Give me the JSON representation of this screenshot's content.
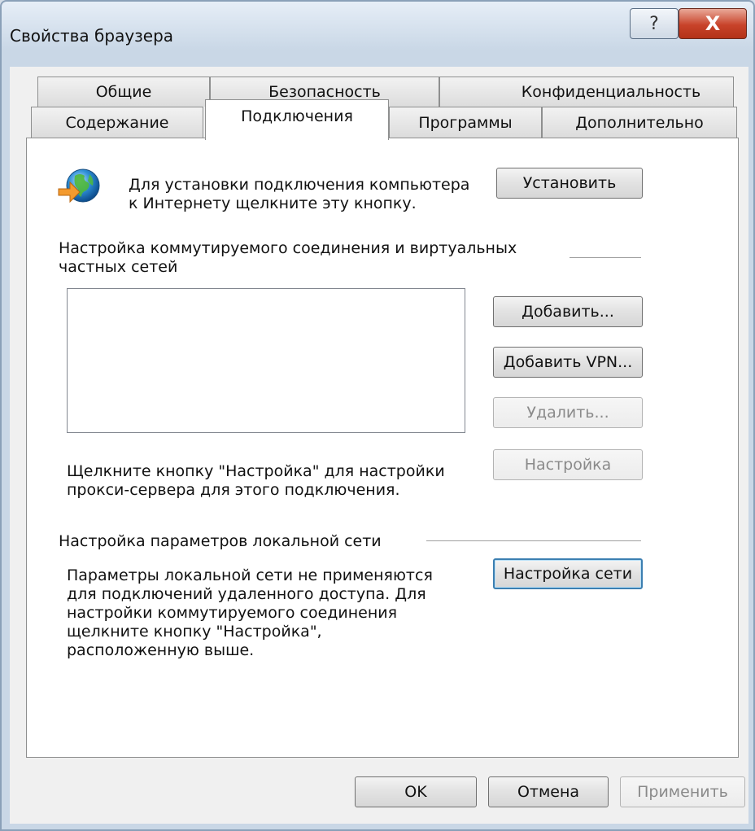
{
  "window": {
    "title": "Свойства браузера",
    "help_glyph": "?",
    "close_glyph": "X"
  },
  "tabs_row1": [
    "Общие",
    "Безопасность",
    "Конфиденциальность"
  ],
  "tabs_row2": [
    "Содержание",
    "Подключения",
    "Программы",
    "Дополнительно"
  ],
  "active_tab": "Подключения",
  "setup": {
    "text": "Для установки подключения компьютера\nк Интернету щелкните эту кнопку.",
    "button": "Установить"
  },
  "dialup": {
    "heading": "Настройка коммутируемого соединения и виртуальных\nчастных сетей",
    "add_button": "Добавить...",
    "add_vpn_button": "Добавить VPN...",
    "remove_button": "Удалить...",
    "proxy_text": "Щелкните кнопку \"Настройка\" для настройки\nпрокси-сервера для этого подключения.",
    "settings_button": "Настройка"
  },
  "lan": {
    "heading": "Настройка параметров локальной сети",
    "text": "Параметры локальной сети не применяются\nдля подключений удаленного доступа. Для\nнастройки коммутируемого соединения\nщелкните кнопку \"Настройка\",\nрасположенную выше.",
    "button": "Настройка сети"
  },
  "footer": {
    "ok": "OK",
    "cancel": "Отмена",
    "apply": "Применить"
  },
  "icons": {
    "connection": "globe-network-icon"
  }
}
